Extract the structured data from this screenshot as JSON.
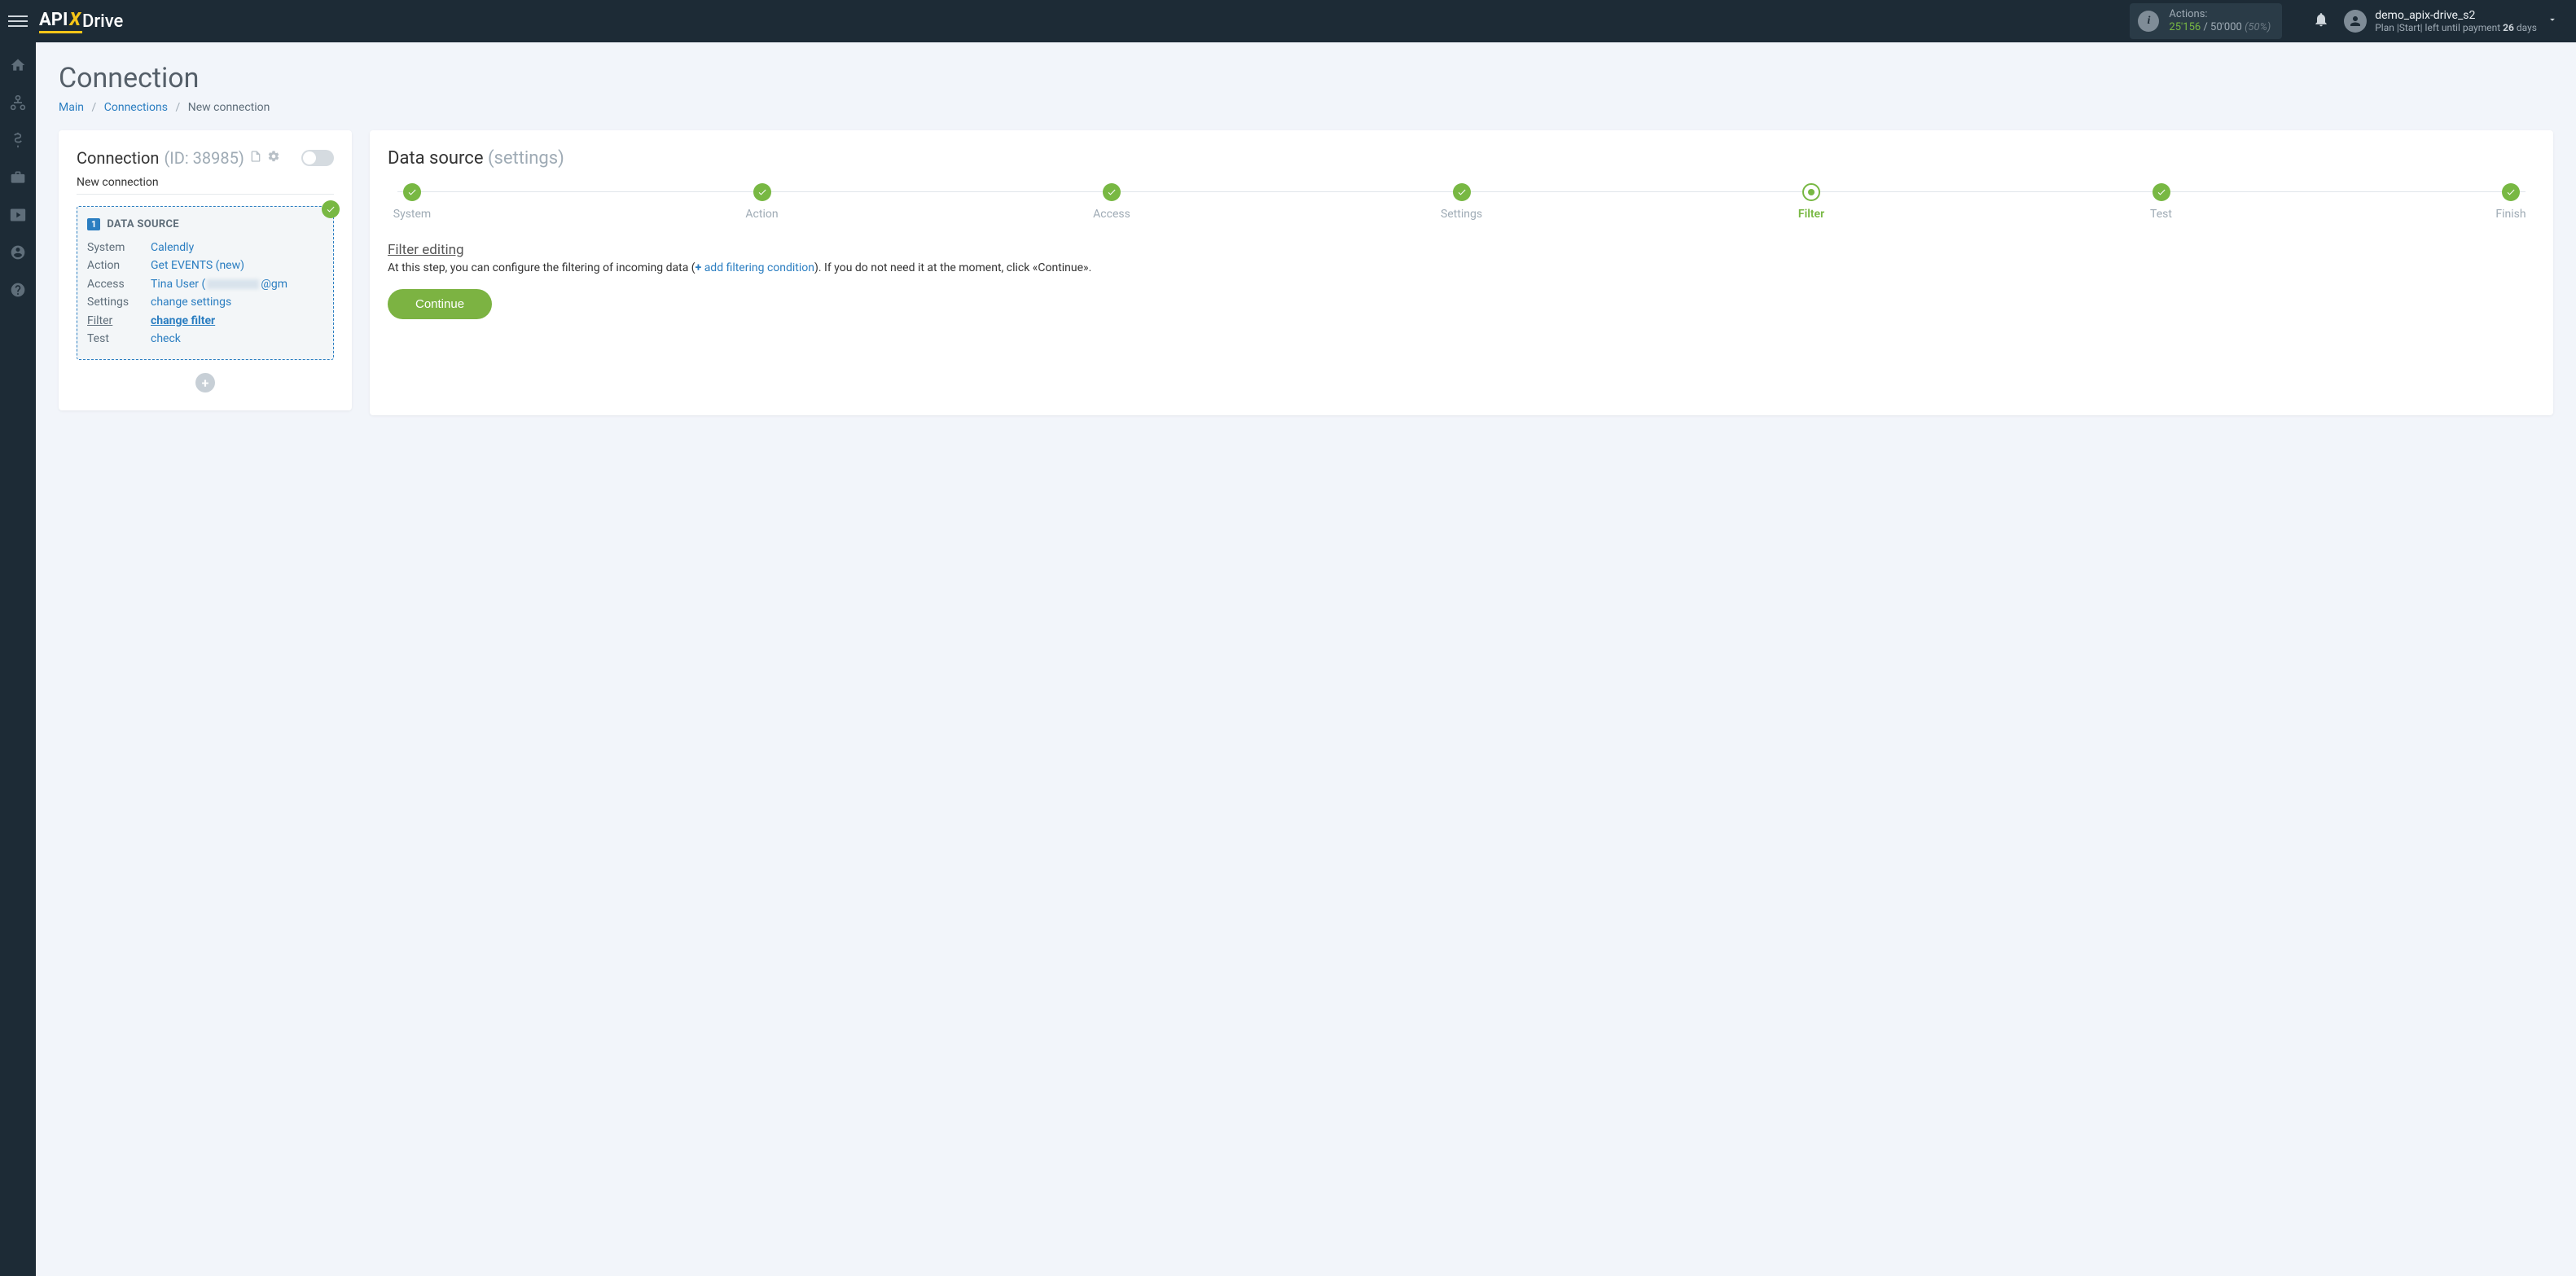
{
  "topbar": {
    "actions_label": "Actions:",
    "actions_used": "25'156",
    "actions_sep": " / ",
    "actions_total": "50'000",
    "actions_pct": "(50%)",
    "username": "demo_apix-drive_s2",
    "plan_prefix": "Plan |Start|  left until payment ",
    "plan_days_num": "26",
    "plan_days_unit": " days"
  },
  "page": {
    "title": "Connection",
    "breadcrumb": {
      "main": "Main",
      "connections": "Connections",
      "current": "New connection"
    }
  },
  "left": {
    "title": "Connection",
    "id_label": "(ID: 38985)",
    "conn_name": "New connection",
    "ds_badge": "1",
    "ds_title": "DATA SOURCE",
    "rows": {
      "system": {
        "label": "System",
        "value": "Calendly"
      },
      "action": {
        "label": "Action",
        "value": "Get EVENTS (new)"
      },
      "access": {
        "label": "Access",
        "prefix": "Tina User (",
        "suffix": "@gm"
      },
      "settings": {
        "label": "Settings",
        "value": "change settings"
      },
      "filter": {
        "label": "Filter",
        "value": "change filter"
      },
      "test": {
        "label": "Test",
        "value": "check"
      }
    }
  },
  "right": {
    "title": "Data source",
    "subtitle": "(settings)",
    "steps": [
      "System",
      "Action",
      "Access",
      "Settings",
      "Filter",
      "Test",
      "Finish"
    ],
    "filter_heading": "Filter editing",
    "filter_desc_1": "At this step, you can configure the filtering of incoming data (",
    "filter_add": "add filtering condition",
    "filter_desc_2": "). If you do not need it at the moment, click «Continue».",
    "continue": "Continue"
  }
}
